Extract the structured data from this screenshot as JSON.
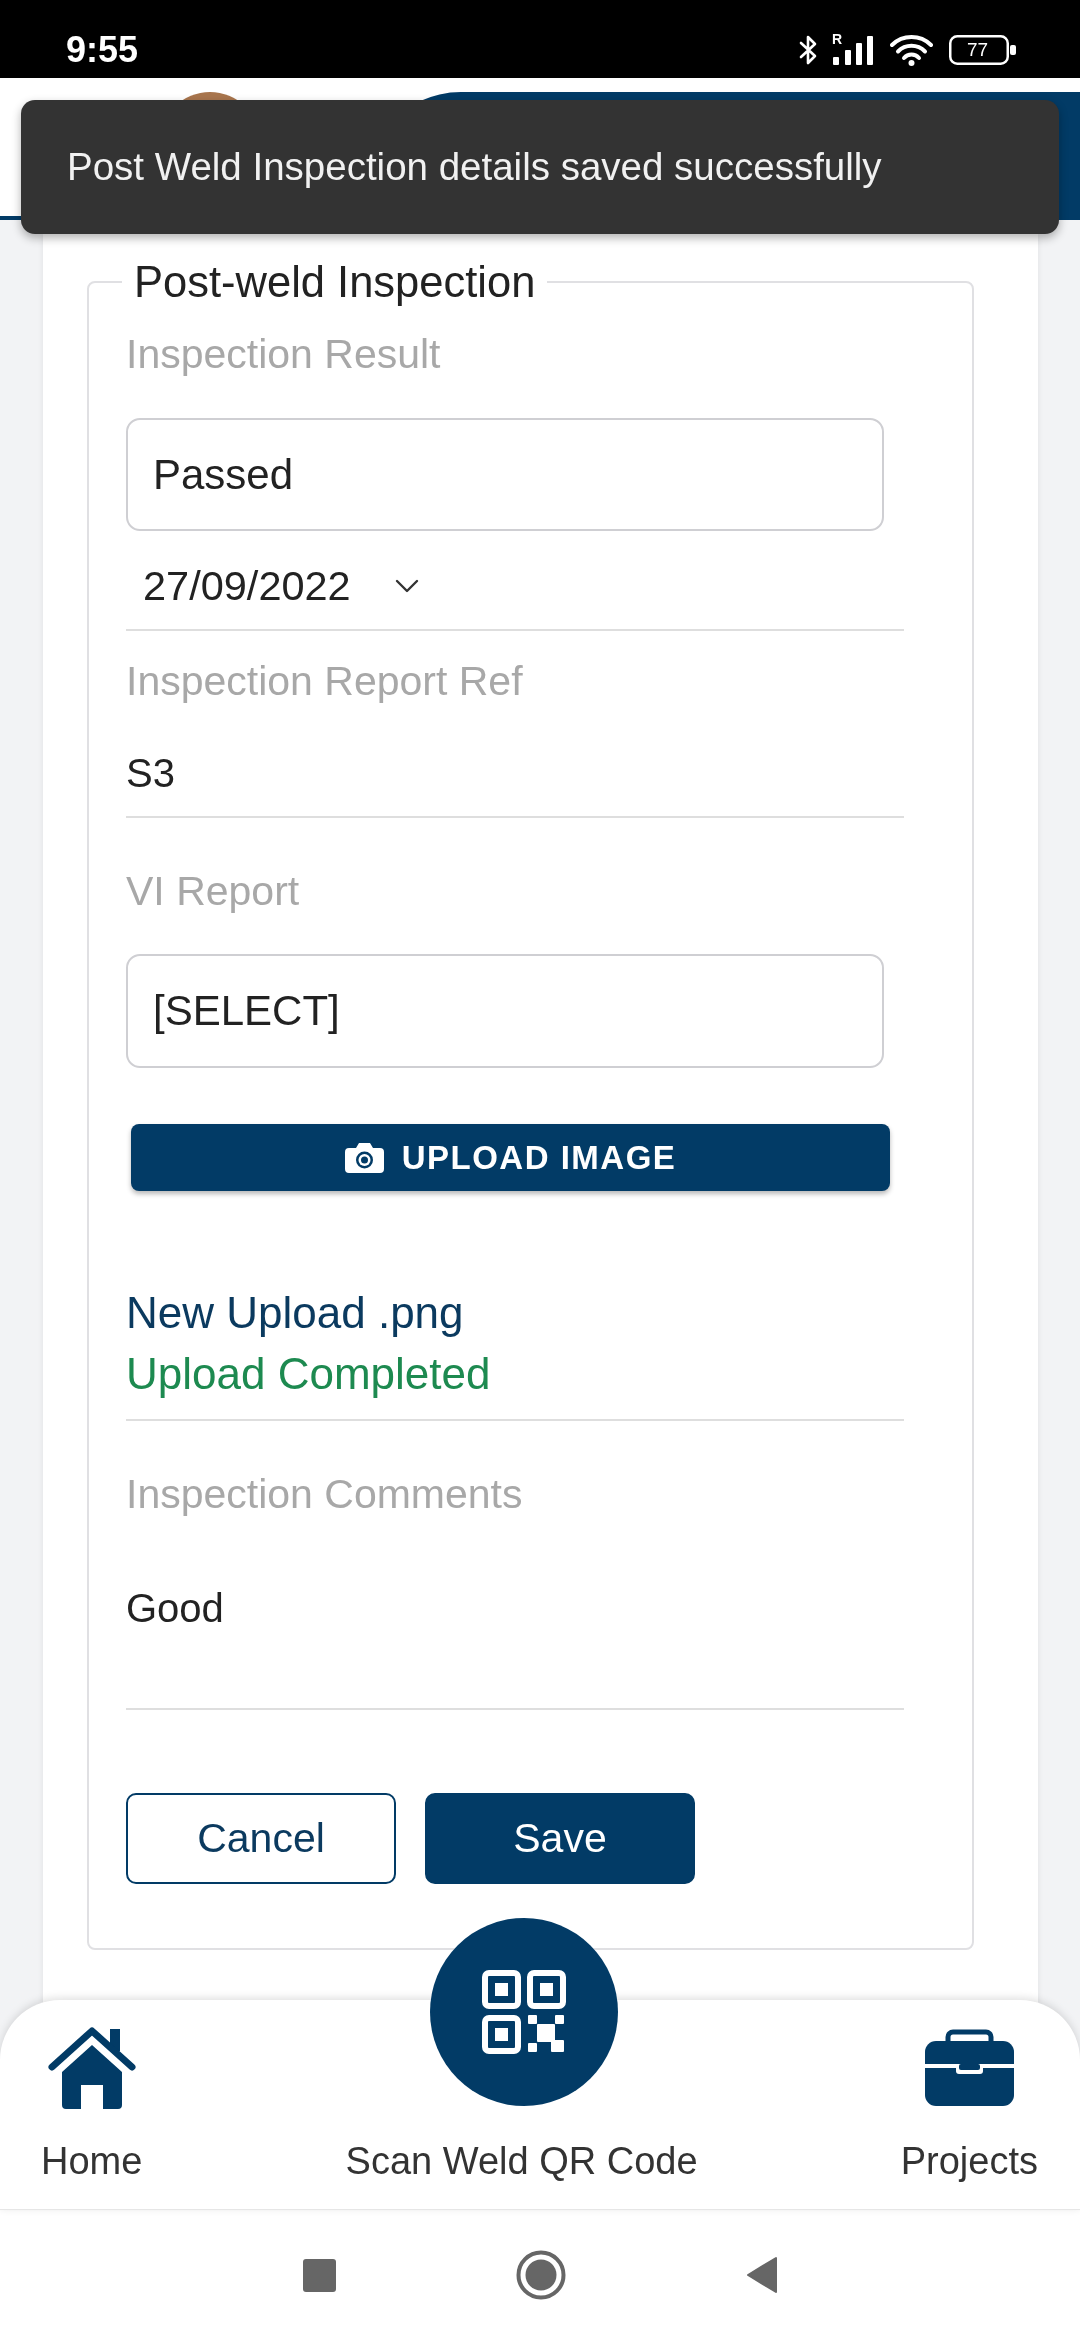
{
  "status_bar": {
    "time": "9:55",
    "network": "R",
    "battery": "77"
  },
  "toast": {
    "message": "Post Weld Inspection details saved successfully"
  },
  "form": {
    "title": "Post-weld Inspection",
    "inspection_result": {
      "label": "Inspection Result",
      "value": "Passed",
      "date": "27/09/2022"
    },
    "report_ref": {
      "label": "Inspection Report Ref",
      "value": "S3"
    },
    "vi_report": {
      "label": "VI Report",
      "value": "[SELECT]",
      "upload_button": "UPLOAD IMAGE",
      "file_name": "New Upload .png",
      "upload_status": "Upload Completed"
    },
    "comments": {
      "label": "Inspection Comments",
      "value": "Good"
    },
    "buttons": [
      {
        "label": "Cancel",
        "kind": "outline"
      },
      {
        "label": "Save",
        "kind": "filled"
      }
    ]
  },
  "bottom_nav": {
    "items": [
      {
        "label": "Home"
      },
      {
        "label": "Scan Weld QR Code"
      },
      {
        "label": "Projects"
      }
    ]
  }
}
